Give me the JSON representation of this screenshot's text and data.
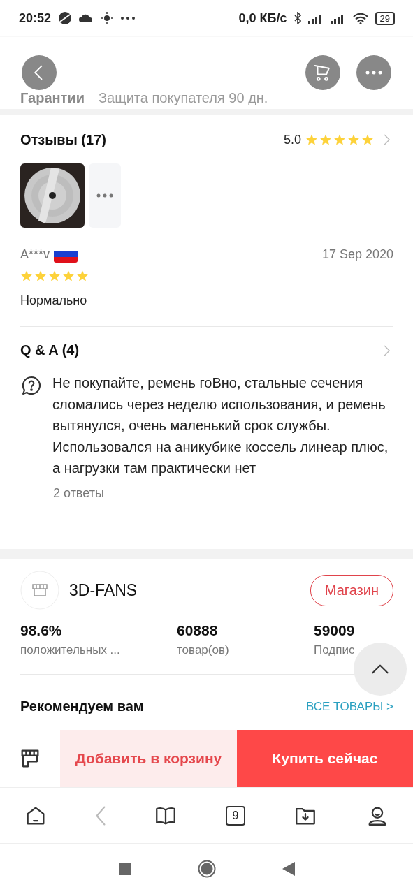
{
  "status_bar": {
    "time": "20:52",
    "speed": "0,0 КБ/с",
    "battery": "29"
  },
  "header_behind": {
    "label": "Гарантии",
    "value": "Защита покупателя 90 дн."
  },
  "reviews": {
    "title": "Отзывы (17)",
    "rating": "5.0",
    "stars": 5,
    "media": [
      {
        "kind": "picture"
      },
      {
        "kind": "more"
      }
    ],
    "review": {
      "author": "A***v",
      "date": "17 Sep 2020",
      "stars": 5,
      "text": "Нормально"
    }
  },
  "qa": {
    "title": "Q & A (4)",
    "question": "Не покупайте, ремень гоВно, стальные сечения сломались через неделю использования, и ремень вытянулся, очень маленький срок службы. Использовался на аникубике коссель линеар плюс, а нагрузки там практически нет",
    "answers": "2 ответы"
  },
  "store": {
    "name": "3D-FANS",
    "button": "Магазин",
    "stats": [
      {
        "value": "98.6%",
        "label": "положительных ..."
      },
      {
        "value": "60888",
        "label": "товар(ов)"
      },
      {
        "value": "59009",
        "label": "Подпис"
      }
    ],
    "recommend": "Рекомендуем вам",
    "all_link": "ВСЕ ТОВАРЫ >"
  },
  "actions": {
    "add_to_cart": "Добавить в корзину",
    "buy_now": "Купить сейчас"
  },
  "browser_nav": {
    "tabs_count": "9"
  }
}
